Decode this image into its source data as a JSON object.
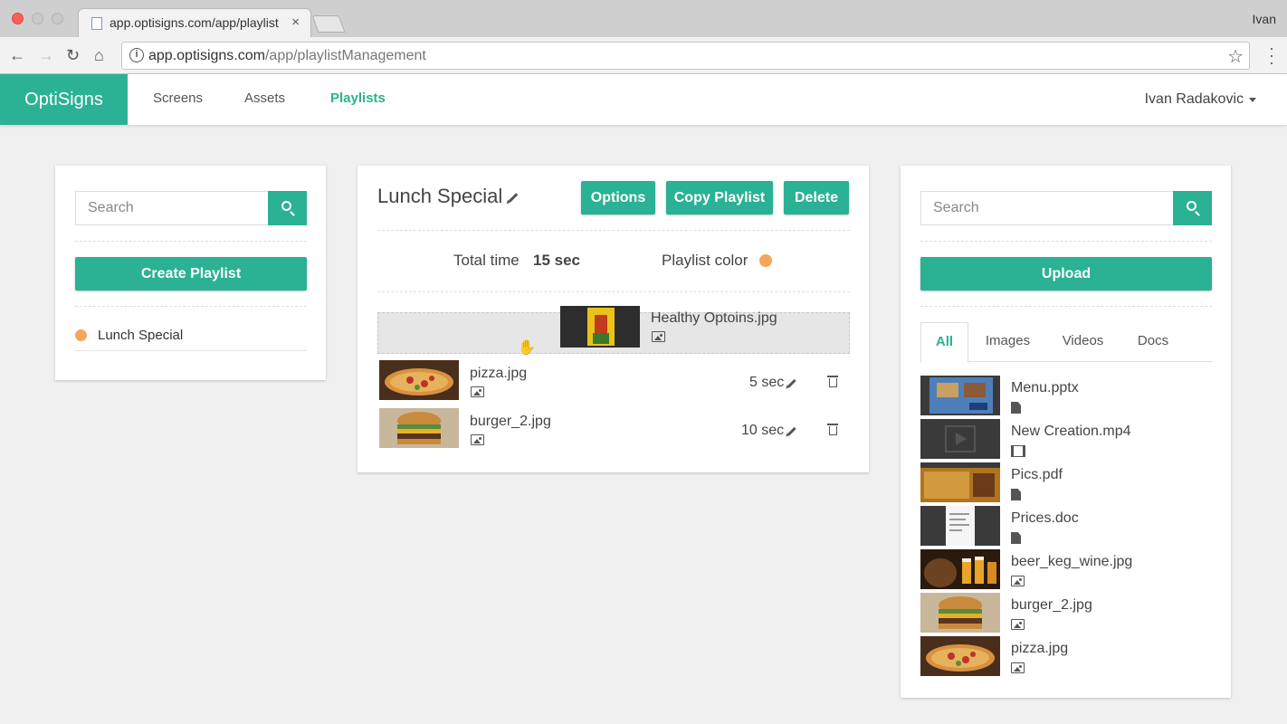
{
  "browser": {
    "tab_title": "app.optisigns.com/app/playlist",
    "tab_close": "×",
    "user": "Ivan",
    "url_host": "app.optisigns.com",
    "url_path": "/app/playlistManagement"
  },
  "nav": {
    "brand": "OptiSigns",
    "screens": "Screens",
    "assets": "Assets",
    "playlists": "Playlists",
    "user": "Ivan Radakovic"
  },
  "left": {
    "search_placeholder": "Search",
    "create_label": "Create Playlist",
    "playlists": [
      {
        "name": "Lunch Special",
        "color": "#f6a55a"
      }
    ]
  },
  "middle": {
    "title": "Lunch Special",
    "options_label": "Options",
    "copy_label": "Copy Playlist",
    "delete_label": "Delete",
    "total_time_label": "Total time",
    "total_time_value": "15 sec",
    "color_label": "Playlist color",
    "playlist_color": "#f6a55a",
    "dragging_item": "Healthy Optoins.jpg",
    "items": [
      {
        "name": "pizza.jpg",
        "duration": "5 sec"
      },
      {
        "name": "burger_2.jpg",
        "duration": "10 sec"
      }
    ]
  },
  "right": {
    "search_placeholder": "Search",
    "upload_label": "Upload",
    "tabs": [
      "All",
      "Images",
      "Videos",
      "Docs"
    ],
    "active_tab": "All",
    "assets": [
      {
        "name": "Menu.pptx",
        "kind": "doc-icon"
      },
      {
        "name": "New Creation.mp4",
        "kind": "film-icon"
      },
      {
        "name": "Pics.pdf",
        "kind": "doc-icon"
      },
      {
        "name": "Prices.doc",
        "kind": "doc-icon"
      },
      {
        "name": "beer_keg_wine.jpg",
        "kind": "image-icon"
      },
      {
        "name": "burger_2.jpg",
        "kind": "image-icon"
      },
      {
        "name": "pizza.jpg",
        "kind": "image-icon"
      }
    ]
  },
  "colors": {
    "accent": "#2bb193",
    "playlist_dot": "#f6a55a"
  }
}
